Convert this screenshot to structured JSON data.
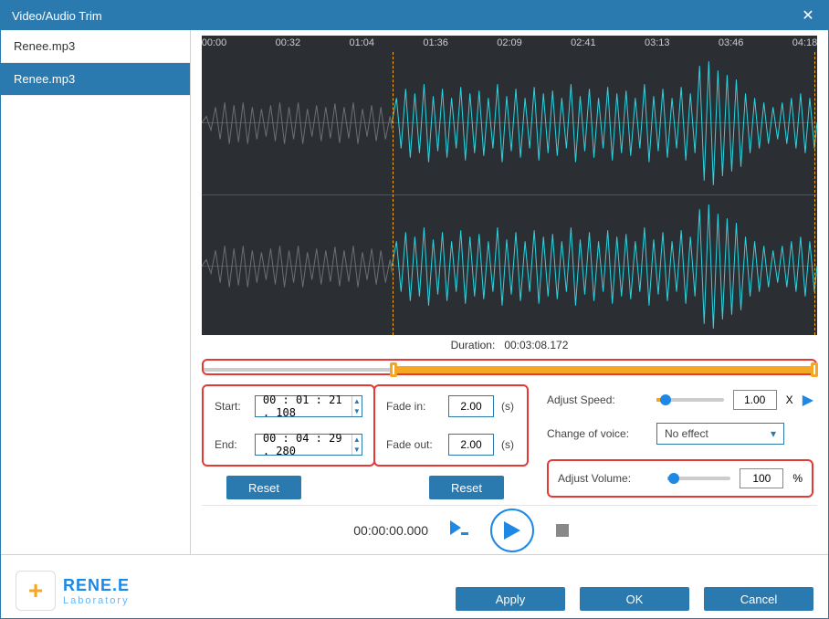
{
  "window": {
    "title": "Video/Audio Trim"
  },
  "sidebar": {
    "items": [
      "Renee.mp3",
      "Renee.mp3"
    ],
    "selected": 1
  },
  "ruler": [
    "00:00",
    "00:32",
    "01:04",
    "01:36",
    "02:09",
    "02:41",
    "03:13",
    "03:46",
    "04:18"
  ],
  "duration": {
    "label": "Duration:",
    "value": "00:03:08.172"
  },
  "trim": {
    "start_label": "Start:",
    "start_value": "00 : 01 : 21 . 108",
    "end_label": "End:",
    "end_value": "00 : 04 : 29 . 280",
    "reset": "Reset"
  },
  "fade": {
    "in_label": "Fade in:",
    "in_value": "2.00",
    "in_unit": "(s)",
    "out_label": "Fade out:",
    "out_value": "2.00",
    "out_unit": "(s)",
    "reset": "Reset"
  },
  "speed": {
    "label": "Adjust Speed:",
    "value": "1.00",
    "unit": "X"
  },
  "voice": {
    "label": "Change of voice:",
    "value": "No effect"
  },
  "volume": {
    "label": "Adjust Volume:",
    "value": "100",
    "unit": "%"
  },
  "playback": {
    "time": "00:00:00.000"
  },
  "logo": {
    "brand": "RENE.E",
    "sub": "Laboratory"
  },
  "footer": {
    "apply": "Apply",
    "ok": "OK",
    "cancel": "Cancel"
  }
}
